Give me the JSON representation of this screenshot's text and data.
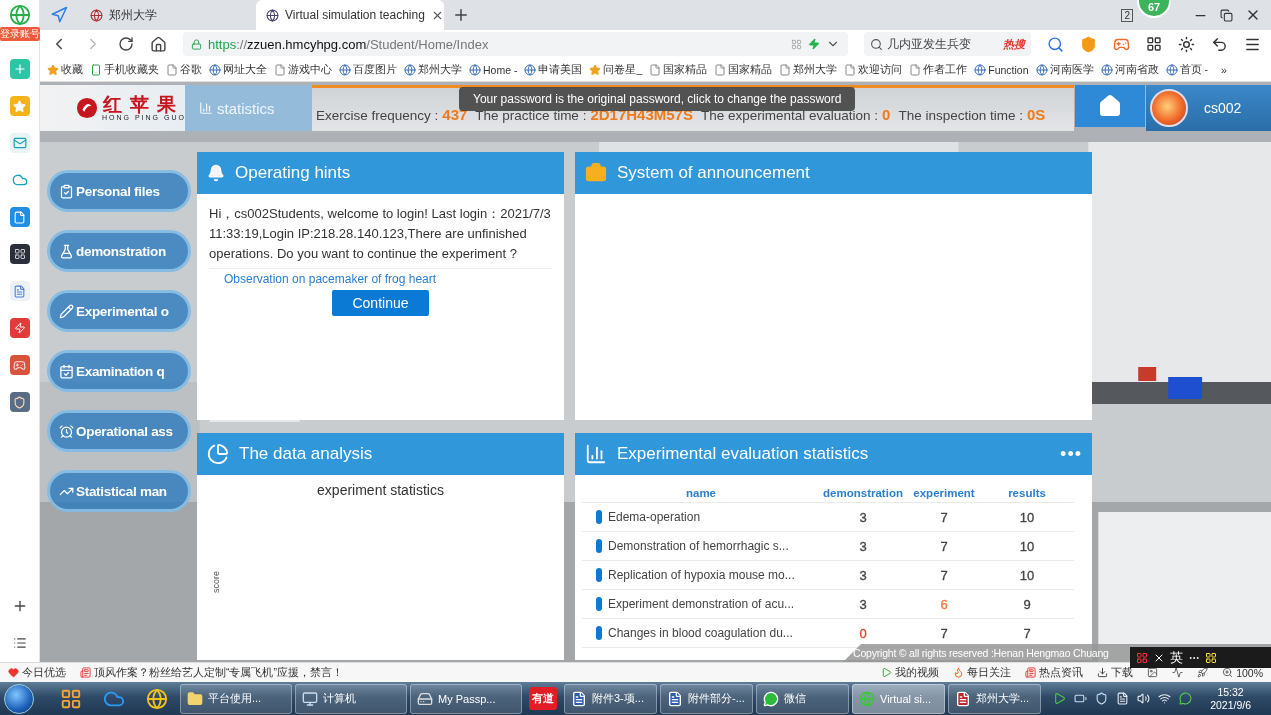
{
  "browser": {
    "sidebar": {
      "badge": "登录账号"
    },
    "tabs": [
      {
        "label": "郑州大学",
        "selected": false
      },
      {
        "label": "Virtual simulation teaching",
        "selected": true
      }
    ],
    "window_count": "2",
    "notification_count": "67",
    "address": {
      "scheme": "https",
      "separator": "://",
      "host": "zzuen.hmcyhpg.com",
      "path": "/Student/Home/Index"
    },
    "search": {
      "value": "几内亚发生兵变",
      "tag": "热搜"
    },
    "bookmarks": [
      {
        "label": "收藏",
        "kind": "star"
      },
      {
        "label": "手机收藏夹",
        "kind": "phone"
      },
      {
        "label": "谷歌",
        "kind": "file"
      },
      {
        "label": "网址大全",
        "kind": "site"
      },
      {
        "label": "游戏中心",
        "kind": "file"
      },
      {
        "label": "百度图片",
        "kind": "site"
      },
      {
        "label": "郑州大学",
        "kind": "site"
      },
      {
        "label": "Home -",
        "kind": "site"
      },
      {
        "label": "申请美国",
        "kind": "site"
      },
      {
        "label": "问卷星_",
        "kind": "star"
      },
      {
        "label": "国家精品",
        "kind": "file"
      },
      {
        "label": "国家精品",
        "kind": "file"
      },
      {
        "label": "郑州大学",
        "kind": "file"
      },
      {
        "label": "欢迎访问",
        "kind": "file"
      },
      {
        "label": "作者工作",
        "kind": "file"
      },
      {
        "label": "Function",
        "kind": "site"
      },
      {
        "label": "河南医学",
        "kind": "site"
      },
      {
        "label": "河南省政",
        "kind": "site"
      },
      {
        "label": "首页 -",
        "kind": "site"
      }
    ],
    "bookmarks_more": "»"
  },
  "page": {
    "logo": {
      "name": "红苹果",
      "pinyin": "HONG PING GUO"
    },
    "section_tab": "statistics",
    "stats": [
      {
        "label": "Exercise frequency :",
        "value": "437"
      },
      {
        "label": "The practice time :",
        "value": "2D17H43M57S"
      },
      {
        "label": "The experimental evaluation :",
        "value": "0"
      },
      {
        "label": "The inspection time :",
        "value": "0S"
      }
    ],
    "tooltip": "Your password is the original password, click to change the password",
    "user": "cs002",
    "menu": [
      {
        "label": "Personal files",
        "kind": "files"
      },
      {
        "label": "demonstration",
        "kind": "demo"
      },
      {
        "label": "Experimental o",
        "kind": "experiment"
      },
      {
        "label": "Examination q",
        "kind": "exam"
      },
      {
        "label": "Operational ass",
        "kind": "assess"
      },
      {
        "label": "Statistical man",
        "kind": "stats"
      }
    ],
    "hints": {
      "title": "Operating hints",
      "message": "Hi，cs002Students, welcome to login! Last login：2021/7/3 11:33:19,Login IP:218.28.140.123,There are unfinished operations. Do you want to continue the experiment ?",
      "link": "Observation on pacemaker of frog heart",
      "button": "Continue"
    },
    "announcement": {
      "title": "System of announcement"
    },
    "analysis": {
      "title": "The data analysis",
      "chart_title": "experiment statistics",
      "ylabel": "score"
    },
    "evaluation": {
      "title": "Experimental evaluation statistics",
      "more": "•••",
      "columns": [
        "name",
        "demonstration",
        "experiment",
        "results"
      ],
      "rows": [
        {
          "name": "Edema-operation",
          "demonstration": {
            "text": "3",
            "color": "#444444"
          },
          "experiment": {
            "text": "7",
            "color": "#444444"
          },
          "results": {
            "text": "10",
            "color": "#444444"
          }
        },
        {
          "name": "Demonstration of hemorrhagic s...",
          "demonstration": {
            "text": "3",
            "color": "#444444"
          },
          "experiment": {
            "text": "7",
            "color": "#444444"
          },
          "results": {
            "text": "10",
            "color": "#444444"
          }
        },
        {
          "name": "Replication of hypoxia mouse mo...",
          "demonstration": {
            "text": "3",
            "color": "#444444"
          },
          "experiment": {
            "text": "7",
            "color": "#444444"
          },
          "results": {
            "text": "10",
            "color": "#444444"
          }
        },
        {
          "name": "Experiment demonstration of acu...",
          "demonstration": {
            "text": "3",
            "color": "#444444"
          },
          "experiment": {
            "text": "6",
            "color": "#f0763a"
          },
          "results": {
            "text": "9",
            "color": "#444444"
          }
        },
        {
          "name": "Changes in blood coagulation du...",
          "demonstration": {
            "text": "0",
            "color": "#e0452c"
          },
          "experiment": {
            "text": "7",
            "color": "#444444"
          },
          "results": {
            "text": "7",
            "color": "#444444"
          }
        }
      ]
    },
    "copyright": "Copyright © all rights reserved :Henan Hengmao Chuang"
  },
  "ime": {
    "label": "英"
  },
  "status_bar": {
    "left": [
      {
        "kind": "heart",
        "text": "今日优选"
      },
      {
        "kind": "news",
        "text": "顶风作案？粉丝给艺人定制“专属飞机”应援，禁言！"
      }
    ],
    "right": [
      {
        "kind": "video",
        "text": "我的视频"
      },
      {
        "kind": "fire",
        "text": "每日关注"
      },
      {
        "kind": "news",
        "text": "热点资讯"
      },
      {
        "kind": "download",
        "text": "下载"
      }
    ],
    "zoom": "100%"
  },
  "taskbar": {
    "windows": [
      {
        "label": "平台使用...",
        "kind": "folder",
        "selected": false
      },
      {
        "label": "计算机",
        "kind": "computer",
        "selected": false
      },
      {
        "label": "My Passp...",
        "kind": "drive",
        "selected": false
      },
      {
        "label": "有道",
        "kind": "youdao",
        "selected": false
      },
      {
        "label": "附件3-项...",
        "kind": "word",
        "selected": false
      },
      {
        "label": "附件部分-...",
        "kind": "word",
        "selected": false
      },
      {
        "label": "微信",
        "kind": "wechat",
        "selected": false
      },
      {
        "label": "Virtual si...",
        "kind": "browser",
        "selected": true
      },
      {
        "label": "郑州大学...",
        "kind": "pdf",
        "selected": false
      }
    ],
    "time": "15:32",
    "date": "2021/9/6"
  }
}
